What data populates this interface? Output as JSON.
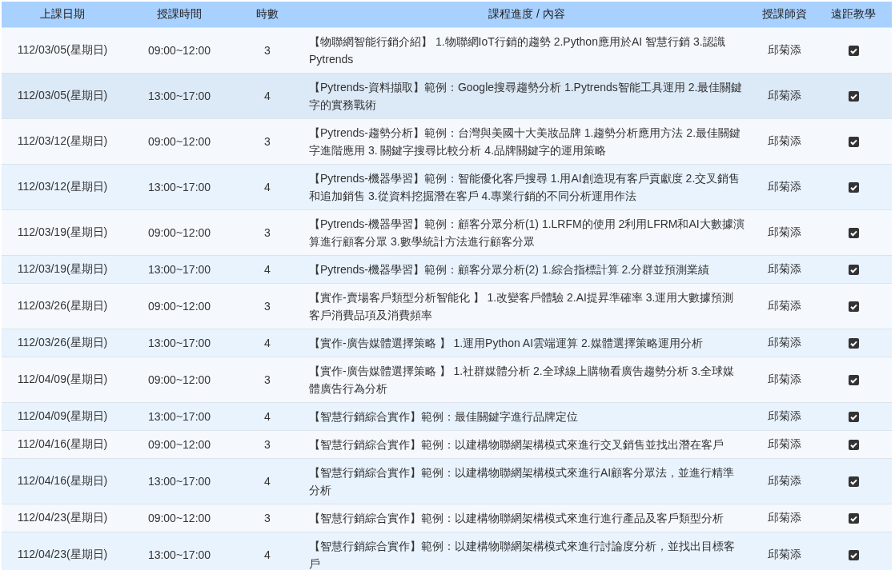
{
  "table": {
    "columns": [
      "上課日期",
      "授課時間",
      "時數",
      "課程進度 / 內容",
      "授課師資",
      "遠距教學"
    ],
    "rows": [
      {
        "date": "112/03/05(星期日)",
        "time": "09:00~12:00",
        "hours": "3",
        "content": "【物聯網智能行銷介紹】 1.物聯網IoT行銷的趨勢 2.Python應用於AI 智慧行銷 3.認識Pytrends",
        "teacher": "邱菊添",
        "remote": true,
        "selected": false
      },
      {
        "date": "112/03/05(星期日)",
        "time": "13:00~17:00",
        "hours": "4",
        "content": "【Pytrends-資料擷取】範例：Google搜尋趨勢分析 1.Pytrends智能工具運用 2.最佳關鍵字的實務戰術",
        "teacher": "邱菊添",
        "remote": true,
        "selected": true
      },
      {
        "date": "112/03/12(星期日)",
        "time": "09:00~12:00",
        "hours": "3",
        "content": "【Pytrends-趨勢分析】範例：台灣與美國十大美妝品牌 1.趨勢分析應用方法 2.最佳關鍵字進階應用 3. 關鍵字搜尋比較分析 4.品牌關鍵字的運用策略",
        "teacher": "邱菊添",
        "remote": true,
        "selected": false
      },
      {
        "date": "112/03/12(星期日)",
        "time": "13:00~17:00",
        "hours": "4",
        "content": "【Pytrends-機器學習】範例：智能優化客戶搜尋 1.用AI創造現有客戶貢獻度 2.交叉銷售和追加銷售 3.從資料挖掘潛在客戶 4.專業行銷的不同分析運用作法",
        "teacher": "邱菊添",
        "remote": true,
        "selected": false
      },
      {
        "date": "112/03/19(星期日)",
        "time": "09:00~12:00",
        "hours": "3",
        "content": "【Pytrends-機器學習】範例：顧客分眾分析(1) 1.LRFM的使用 2利用LFRM和AI大數據演算進行顧客分眾 3.數學統計方法進行顧客分眾",
        "teacher": "邱菊添",
        "remote": true,
        "selected": false
      },
      {
        "date": "112/03/19(星期日)",
        "time": "13:00~17:00",
        "hours": "4",
        "content": "【Pytrends-機器學習】範例：顧客分眾分析(2) 1.綜合指標計算 2.分群並預測業績",
        "teacher": "邱菊添",
        "remote": true,
        "selected": false
      },
      {
        "date": "112/03/26(星期日)",
        "time": "09:00~12:00",
        "hours": "3",
        "content": "【實作-賣場客戶類型分析智能化 】 1.改變客戶體驗 2.AI提昇準確率 3.運用大數據預測客戶消費品項及消費頻率",
        "teacher": "邱菊添",
        "remote": true,
        "selected": false
      },
      {
        "date": "112/03/26(星期日)",
        "time": "13:00~17:00",
        "hours": "4",
        "content": "【實作-廣告媒體選擇策略 】 1.運用Python AI雲端運算 2.媒體選擇策略運用分析",
        "teacher": "邱菊添",
        "remote": true,
        "selected": false
      },
      {
        "date": "112/04/09(星期日)",
        "time": "09:00~12:00",
        "hours": "3",
        "content": "【實作-廣告媒體選擇策略 】 1.社群媒體分析 2.全球線上購物看廣告趨勢分析 3.全球媒體廣告行為分析",
        "teacher": "邱菊添",
        "remote": true,
        "selected": false
      },
      {
        "date": "112/04/09(星期日)",
        "time": "13:00~17:00",
        "hours": "4",
        "content": "【智慧行銷綜合實作】範例：最佳關鍵字進行品牌定位",
        "teacher": "邱菊添",
        "remote": true,
        "selected": false
      },
      {
        "date": "112/04/16(星期日)",
        "time": "09:00~12:00",
        "hours": "3",
        "content": "【智慧行銷綜合實作】範例：以建構物聯網架構模式來進行交叉銷售並找出潛在客戶",
        "teacher": "邱菊添",
        "remote": true,
        "selected": false
      },
      {
        "date": "112/04/16(星期日)",
        "time": "13:00~17:00",
        "hours": "4",
        "content": "【智慧行銷綜合實作】範例：以建構物聯網架構模式來進行AI顧客分眾法，並進行精準分析",
        "teacher": "邱菊添",
        "remote": true,
        "selected": false
      },
      {
        "date": "112/04/23(星期日)",
        "time": "09:00~12:00",
        "hours": "3",
        "content": "【智慧行銷綜合實作】範例：以建構物聯網架構模式來進行進行產品及客戶類型分析",
        "teacher": "邱菊添",
        "remote": true,
        "selected": false
      },
      {
        "date": "112/04/23(星期日)",
        "time": "13:00~17:00",
        "hours": "4",
        "content": "【智慧行銷綜合實作】範例：以建構物聯網架構模式來進行討論度分析，並找出目標客戶",
        "teacher": "邱菊添",
        "remote": true,
        "selected": false
      }
    ]
  }
}
